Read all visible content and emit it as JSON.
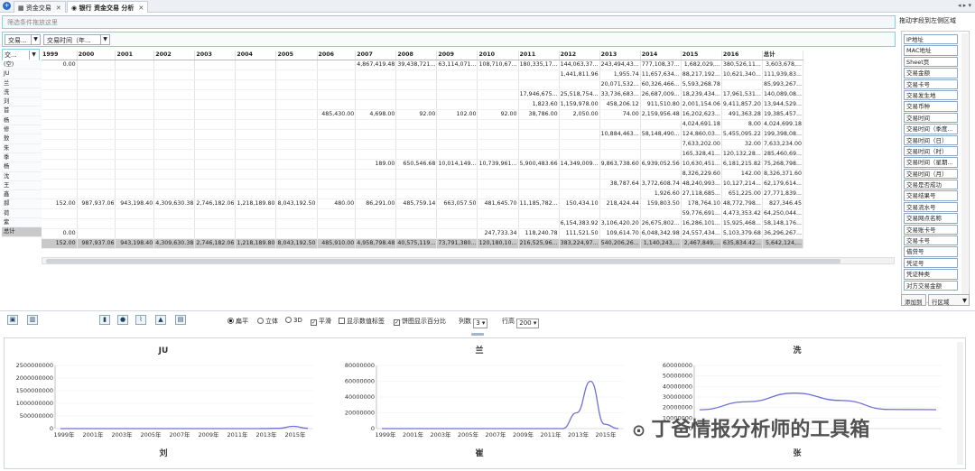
{
  "tabs": [
    {
      "label": "资金交易",
      "active": false
    },
    {
      "label": "银行 资金交易 分析",
      "active": true
    }
  ],
  "filter_placeholder": "筛选条件拖放这里",
  "column_fields": [
    {
      "label": "交易..."
    },
    {
      "label": "交易时间（年..."
    }
  ],
  "row_field": {
    "label": "交..."
  },
  "pivot": {
    "columns": [
      "1999",
      "2000",
      "2001",
      "2002",
      "2003",
      "2004",
      "2005",
      "2006",
      "2007",
      "2008",
      "2009",
      "2010",
      "2011",
      "2012",
      "2013",
      "2014",
      "2015",
      "2016",
      "总计"
    ],
    "rows": [
      {
        "label": "(空)",
        "values": [
          "0.00",
          "",
          "",
          "",
          "",
          "",
          "",
          "",
          "4,867,419.48",
          "39,438,721...",
          "63,114,071...",
          "108,710,67...",
          "180,335,17...",
          "144,063,37...",
          "243,494,43...",
          "777,108,37...",
          "1,682,029,...",
          "380,526,11...",
          "3,603,678,..."
        ]
      },
      {
        "label": "JU",
        "values": [
          "",
          "",
          "",
          "",
          "",
          "",
          "",
          "",
          "",
          "",
          "",
          "",
          "",
          "1,441,811.96",
          "1,955.74",
          "11,657,634...",
          "88,217,192...",
          "10,621,340...",
          "111,939,83..."
        ]
      },
      {
        "label": "兰",
        "values": [
          "",
          "",
          "",
          "",
          "",
          "",
          "",
          "",
          "",
          "",
          "",
          "",
          "",
          "",
          "20,071,532...",
          "60,326,466...",
          "5,593,268.78",
          "",
          "85,993,267..."
        ]
      },
      {
        "label": "洗",
        "values": [
          "",
          "",
          "",
          "",
          "",
          "",
          "",
          "",
          "",
          "",
          "",
          "",
          "17,946,675...",
          "25,518,754...",
          "33,736,683...",
          "26,687,009...",
          "18,239,434...",
          "17,961,531...",
          "140,089,08..."
        ]
      },
      {
        "label": "刘",
        "values": [
          "",
          "",
          "",
          "",
          "",
          "",
          "",
          "",
          "",
          "",
          "",
          "",
          "1,823.60",
          "1,159,978.00",
          "458,206.12",
          "911,510.80",
          "2,001,154.06",
          "9,411,857.20",
          "13,944,529..."
        ]
      },
      {
        "label": "首",
        "values": [
          "",
          "",
          "",
          "",
          "",
          "",
          "",
          "485,430.00",
          "4,698.00",
          "92.00",
          "102.00",
          "92.00",
          "38,786.00",
          "2,050.00",
          "74.00",
          "2,159,956.48",
          "16,202,623...",
          "491,363.28",
          "19,385,457..."
        ]
      },
      {
        "label": "杨",
        "values": [
          "",
          "",
          "",
          "",
          "",
          "",
          "",
          "",
          "",
          "",
          "",
          "",
          "",
          "",
          "",
          "",
          "4,024,691.18",
          "8.00",
          "4,024,699.18"
        ]
      },
      {
        "label": "修",
        "values": [
          "",
          "",
          "",
          "",
          "",
          "",
          "",
          "",
          "",
          "",
          "",
          "",
          "",
          "",
          "10,884,463...",
          "58,148,490...",
          "124,860,03...",
          "5,455,095.22",
          "199,398,08..."
        ]
      },
      {
        "label": "敖",
        "values": [
          "",
          "",
          "",
          "",
          "",
          "",
          "",
          "",
          "",
          "",
          "",
          "",
          "",
          "",
          "",
          "",
          "7,633,202.00",
          "32.00",
          "7,633,234.00"
        ]
      },
      {
        "label": "朱",
        "values": [
          "",
          "",
          "",
          "",
          "",
          "",
          "",
          "",
          "",
          "",
          "",
          "",
          "",
          "",
          "",
          "",
          "165,328,41...",
          "120,132,28...",
          "285,460,69..."
        ]
      },
      {
        "label": "季",
        "values": [
          "",
          "",
          "",
          "",
          "",
          "",
          "",
          "",
          "189.00",
          "650,546.68",
          "10,014,149...",
          "10,739,961...",
          "5,900,483.66",
          "14,349,009...",
          "9,863,738.60",
          "6,939,052.56",
          "10,630,451...",
          "6,181,215.82",
          "75,268,798..."
        ]
      },
      {
        "label": "杨",
        "values": [
          "",
          "",
          "",
          "",
          "",
          "",
          "",
          "",
          "",
          "",
          "",
          "",
          "",
          "",
          "",
          "",
          "8,326,229.60",
          "142.00",
          "8,326,371.60"
        ]
      },
      {
        "label": "沈",
        "values": [
          "",
          "",
          "",
          "",
          "",
          "",
          "",
          "",
          "",
          "",
          "",
          "",
          "",
          "",
          "38,787.64",
          "3,772,608.74",
          "48,240,993...",
          "10,127,214...",
          "62,179,614..."
        ]
      },
      {
        "label": "王",
        "values": [
          "",
          "",
          "",
          "",
          "",
          "",
          "",
          "",
          "",
          "",
          "",
          "",
          "",
          "",
          "",
          "",
          "1,926.60",
          "27,118,685...",
          "651,225.00",
          "27,771,839..."
        ]
      },
      {
        "label": "鑫",
        "values": [
          "",
          "152.00",
          "987,937.06",
          "943,198.40",
          "4,309,630.38",
          "2,746,182.06",
          "1,218,189.80",
          "8,043,192.50",
          "480.00",
          "86,291.00",
          "485,759.14",
          "663,057.50",
          "481,645.70",
          "11,185,782...",
          "150,434.10",
          "218,424.44",
          "159,803.50",
          "178,764.10",
          "48,772,798...",
          "827,346.45"
        ]
      },
      {
        "label": "郝",
        "values": [
          "",
          "",
          "",
          "",
          "",
          "",
          "",
          "",
          "",
          "",
          "",
          "",
          "",
          "",
          "",
          "",
          "59,776,691...",
          "4,473,353.42",
          "64,250,044..."
        ]
      },
      {
        "label": "荷",
        "values": [
          "",
          "",
          "",
          "",
          "",
          "",
          "",
          "",
          "",
          "",
          "",
          "",
          "",
          "6,154,383.92",
          "3,106,420.20",
          "26,675,802...",
          "16,286,101...",
          "15,925,468...",
          "58,148,176..."
        ]
      },
      {
        "label": "紫",
        "values": [
          "0.00",
          "",
          "",
          "",
          "",
          "",
          "",
          "",
          "",
          "",
          "",
          "247,733.34",
          "118,240.78",
          "111,521.50",
          "109,614.70",
          "6,048,342.98",
          "24,557,434...",
          "5,103,379.68",
          "36,296,267..."
        ]
      }
    ],
    "total": {
      "label": "总计",
      "values": [
        "0.00",
        "152.00",
        "987,937.06",
        "943,198.40",
        "4,309,630.38",
        "2,746,182.06",
        "1,218,189.80",
        "8,043,192.50",
        "485,910.00",
        "4,958,798.48",
        "40,575,119...",
        "73,791,380...",
        "120,180,10...",
        "216,525,96...",
        "383,224,97...",
        "540,206,26...",
        "1,140,243,...",
        "2,467,849,...",
        "635,834.42...",
        "5,642,124,..."
      ]
    }
  },
  "right_panel": {
    "title": "拖动字段到左侧区域",
    "fields": [
      "IP地址",
      "MAC地址",
      "Sheet页",
      "交易金额",
      "交易卡号",
      "交易发生地",
      "交易币种",
      "交易时间",
      "交易时间（季度...",
      "交易时间（日）",
      "交易时间（时）",
      "交易时间（星期...",
      "交易时间（月）",
      "交易是否成功",
      "交易结果号",
      "交易流水号",
      "交易网点名称",
      "交易账卡号",
      "交易卡号",
      "借贷号",
      "凭证号",
      "凭证种类",
      "对方交易金额"
    ],
    "add_button": "添加到",
    "zone_select": "行区域"
  },
  "toolbar": {
    "options": [
      {
        "label": "扁平",
        "type": "radio",
        "checked": true
      },
      {
        "label": "立体",
        "type": "radio",
        "checked": false
      },
      {
        "label": "3D",
        "type": "radio",
        "checked": false
      },
      {
        "label": "平滑",
        "type": "checkbox",
        "checked": true
      },
      {
        "label": "显示数值标签",
        "type": "checkbox",
        "checked": false
      },
      {
        "label": "饼图显示百分比",
        "type": "checkbox",
        "checked": true
      }
    ],
    "columns_label": "列数",
    "columns_value": "3",
    "rows_label": "行高",
    "rows_value": "200"
  },
  "charts": [
    {
      "title": "JU",
      "bottom_label": "刘",
      "xticks": [
        "1999年",
        "2001年",
        "2003年",
        "2005年",
        "2007年",
        "2009年",
        "2011年",
        "2013年",
        "2015年"
      ],
      "yticks": [
        "2500000000",
        "2000000000",
        "1500000000",
        "1000000000",
        "500000000",
        "0"
      ],
      "ymax": 2500000000,
      "x": [
        "1999",
        "2000",
        "2001",
        "2002",
        "2003",
        "2004",
        "2005",
        "2006",
        "2007",
        "2008",
        "2009",
        "2010",
        "2011",
        "2012",
        "2013",
        "2014",
        "2015",
        "2016"
      ],
      "y": [
        0,
        0,
        0,
        0,
        0,
        0,
        0,
        0,
        0,
        0,
        0,
        0,
        0,
        0,
        2000000,
        12000000,
        88000000,
        11000000
      ]
    },
    {
      "title": "兰",
      "bottom_label": "崔",
      "xticks": [
        "1999年",
        "2001年",
        "2003年",
        "2005年",
        "2007年",
        "2009年",
        "2011年",
        "2013年",
        "2015年"
      ],
      "yticks": [
        "80000000",
        "60000000",
        "40000000",
        "20000000",
        "0"
      ],
      "ymax": 80000000,
      "x": [
        "1999",
        "2000",
        "2001",
        "2002",
        "2003",
        "2004",
        "2005",
        "2006",
        "2007",
        "2008",
        "2009",
        "2010",
        "2011",
        "2012",
        "2013",
        "2014",
        "2015",
        "2016"
      ],
      "y": [
        0,
        0,
        0,
        0,
        0,
        0,
        0,
        0,
        0,
        0,
        0,
        0,
        0,
        0,
        20000000,
        60000000,
        5600000,
        0
      ]
    },
    {
      "title": "洗",
      "bottom_label": "张",
      "xticks": [],
      "yticks": [
        "60000000",
        "50000000",
        "40000000",
        "30000000",
        "20000000",
        "10000000",
        "0"
      ],
      "ymax": 60000000,
      "x": [
        "2011",
        "2012",
        "2013",
        "2014",
        "2015",
        "2016"
      ],
      "y": [
        17900000,
        25500000,
        33700000,
        26700000,
        18200000,
        18000000
      ]
    }
  ],
  "watermark": "情报分析师的工具箱",
  "watermark_prefix": "丁爸",
  "colors": {
    "accent": "#7fd6d6",
    "line": "#6f6fd8",
    "total_row": "#c9c9c9"
  }
}
